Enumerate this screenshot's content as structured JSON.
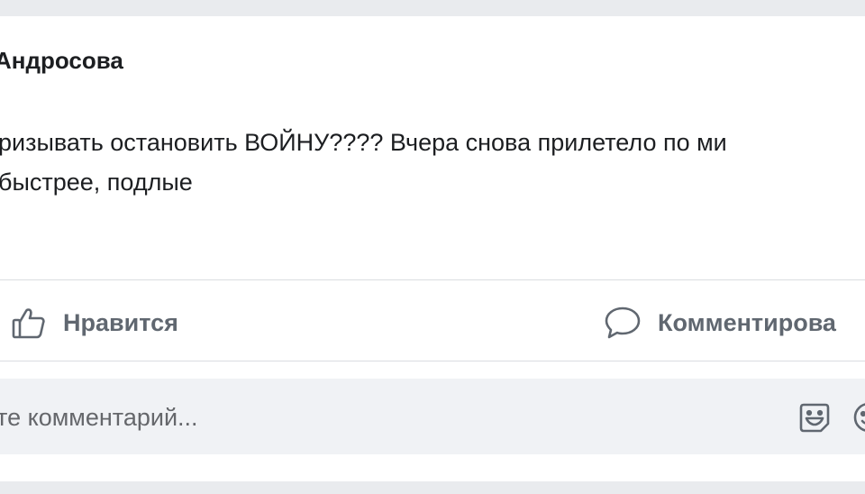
{
  "post": {
    "author": "Андросова",
    "text_line1": "ризывать остановить ВОЙНУ???? Вчера снова прилетело по ми",
    "text_line2": " быстрее, подлые"
  },
  "actions": {
    "like_label": "Нравится",
    "comment_label": "Комментирова"
  },
  "comment_box": {
    "placeholder": "те комментарий..."
  },
  "icons": {
    "like": "thumbs-up-icon",
    "comment": "speech-bubble-icon",
    "sticker": "sticker-icon",
    "emoji": "smiley-icon"
  },
  "colors": {
    "background": "#e9ebee",
    "card": "#ffffff",
    "text": "#1c1e21",
    "muted": "#606770",
    "input_bg": "#f0f2f5"
  }
}
